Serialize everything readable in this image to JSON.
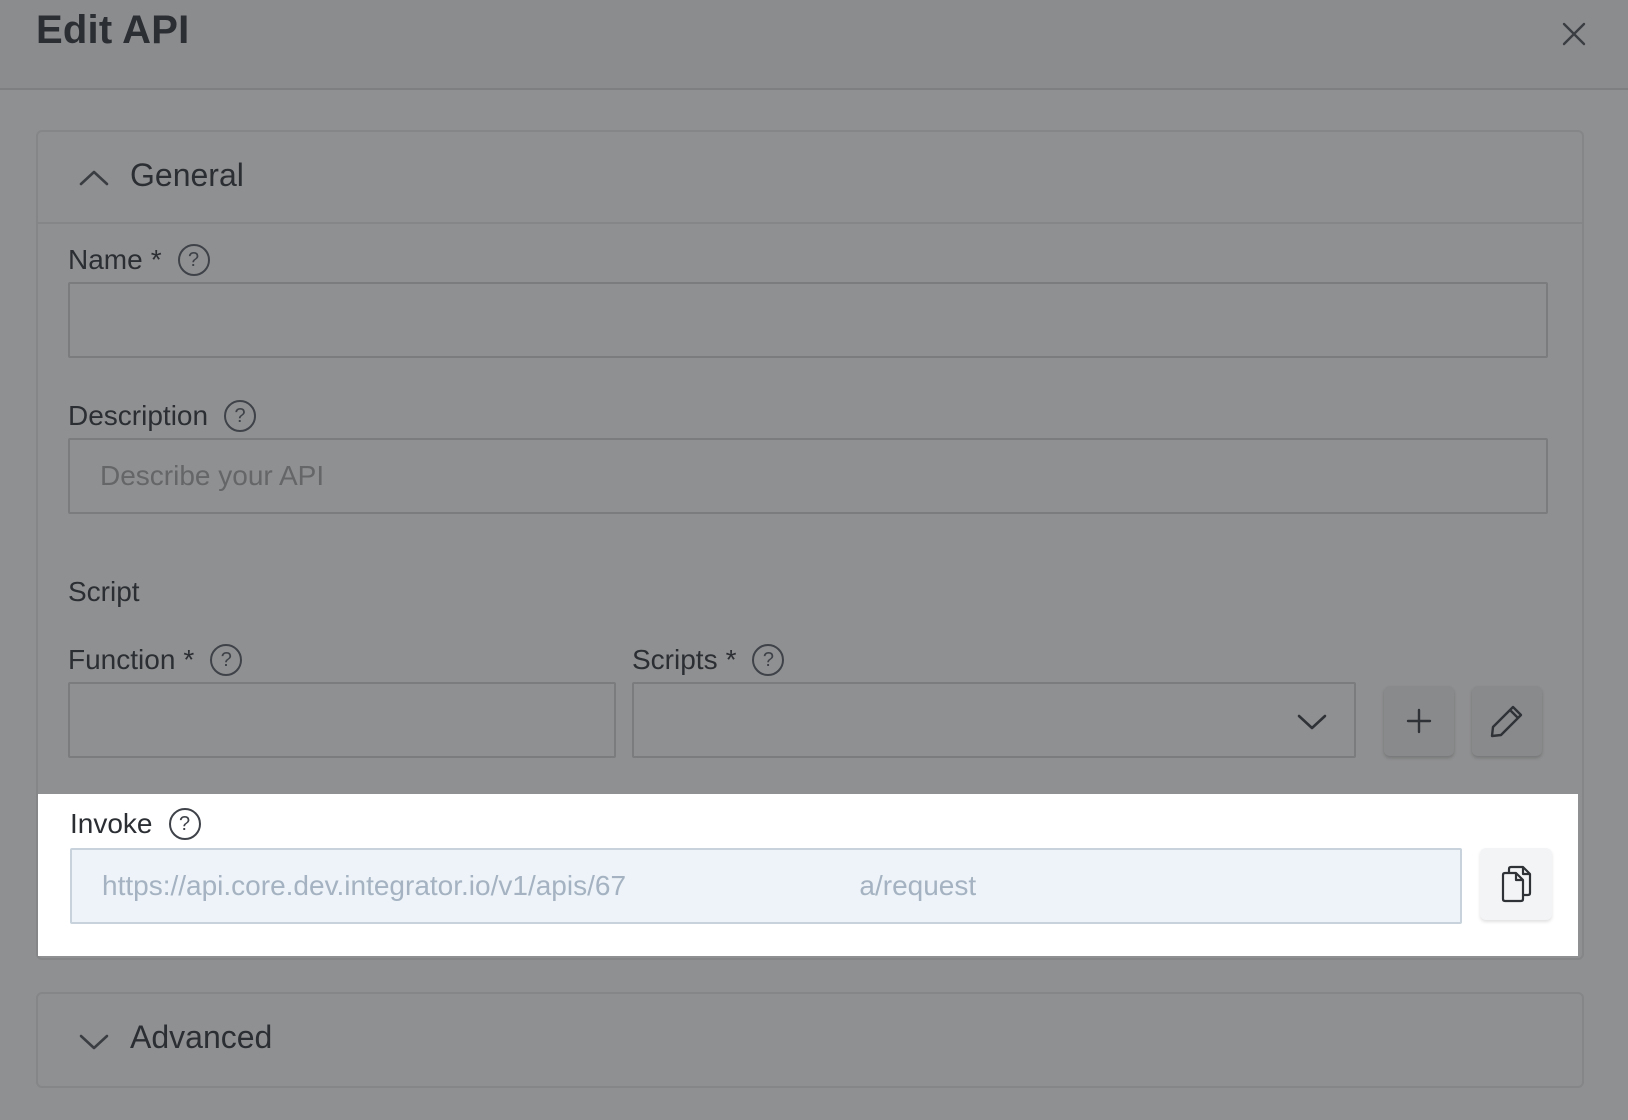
{
  "dialog": {
    "title": "Edit API"
  },
  "general": {
    "label": "General",
    "name": {
      "label": "Name",
      "required": "*",
      "value": ""
    },
    "description": {
      "label": "Description",
      "value": "",
      "placeholder": "Describe your API"
    },
    "script_section": "Script",
    "function": {
      "label": "Function",
      "required": "*",
      "value": ""
    },
    "scripts": {
      "label": "Scripts",
      "required": "*",
      "value": ""
    },
    "invoke": {
      "label": "Invoke",
      "value": "https://api.core.dev.integrator.io/v1/apis/67                              a/request"
    }
  },
  "advanced": {
    "label": "Advanced"
  },
  "icons": {
    "close": "close-icon",
    "help": "help-circle-icon",
    "collapse": "chevron-up-icon",
    "expand": "chevron-down-icon",
    "add": "plus-icon",
    "edit": "pencil-icon",
    "copy": "copy-icon"
  },
  "colors": {
    "overlay": "#8f9091",
    "highlight": "#ffffff",
    "invoke_text": "#a4b2c1"
  }
}
